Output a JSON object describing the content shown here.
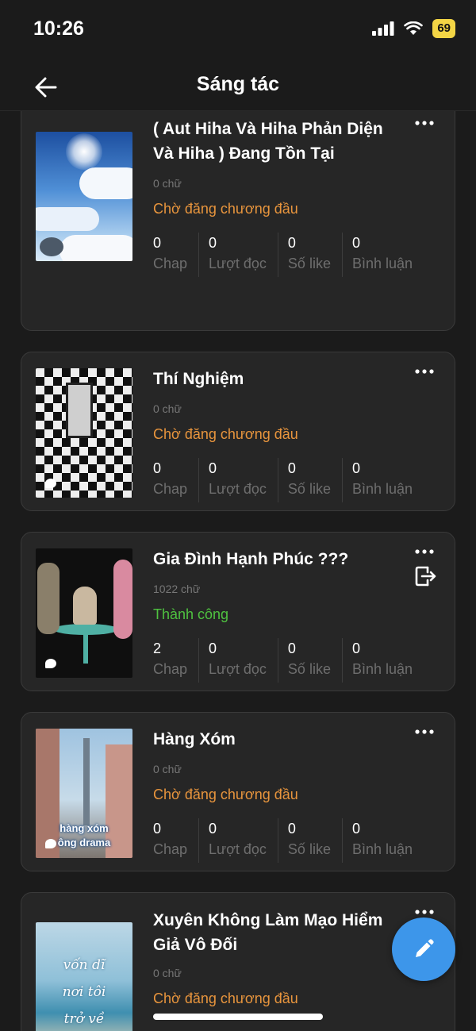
{
  "status_bar": {
    "time": "10:26",
    "battery": "69"
  },
  "header": {
    "title": "Sáng tác"
  },
  "stat_labels": [
    "Chap",
    "Lượt đọc",
    "Số like",
    "Bình luận"
  ],
  "stories": [
    {
      "title": "( Aut Hiha Và Hiha Phản Diện Và Hiha ) Đang Tồn Tại",
      "words": "0 chữ",
      "status": "Chờ đăng chương đầu",
      "stats": [
        "0",
        "0",
        "0",
        "0"
      ]
    },
    {
      "title": "Thí Nghiệm",
      "words": "0 chữ",
      "status": "Chờ đăng chương đầu",
      "stats": [
        "0",
        "0",
        "0",
        "0"
      ]
    },
    {
      "title": "Gia Đình Hạnh Phúc ???",
      "words": "1022 chữ",
      "status": "Thành công",
      "stats": [
        "2",
        "0",
        "0",
        "0"
      ]
    },
    {
      "title": "Hàng Xóm",
      "words": "0 chữ",
      "status": "Chờ đăng chương đầu",
      "stats": [
        "0",
        "0",
        "0",
        "0"
      ],
      "cover_text": [
        "hàng xóm",
        "ông drama"
      ]
    },
    {
      "title": "Xuyên Không Làm Mạo Hiểm Giả Vô Đối",
      "words": "0 chữ",
      "status": "Chờ đăng chương đầu",
      "cover_text": [
        "vốn dĩ",
        "nơi tôi",
        "trở về"
      ]
    }
  ],
  "icons": {
    "back": "arrow-left-icon",
    "more": "more-horizontal-icon",
    "export": "export-icon",
    "fab": "pencil-icon"
  },
  "colors": {
    "pending": "#e8953d",
    "success": "#4fc240",
    "fab": "#3d96ea"
  }
}
